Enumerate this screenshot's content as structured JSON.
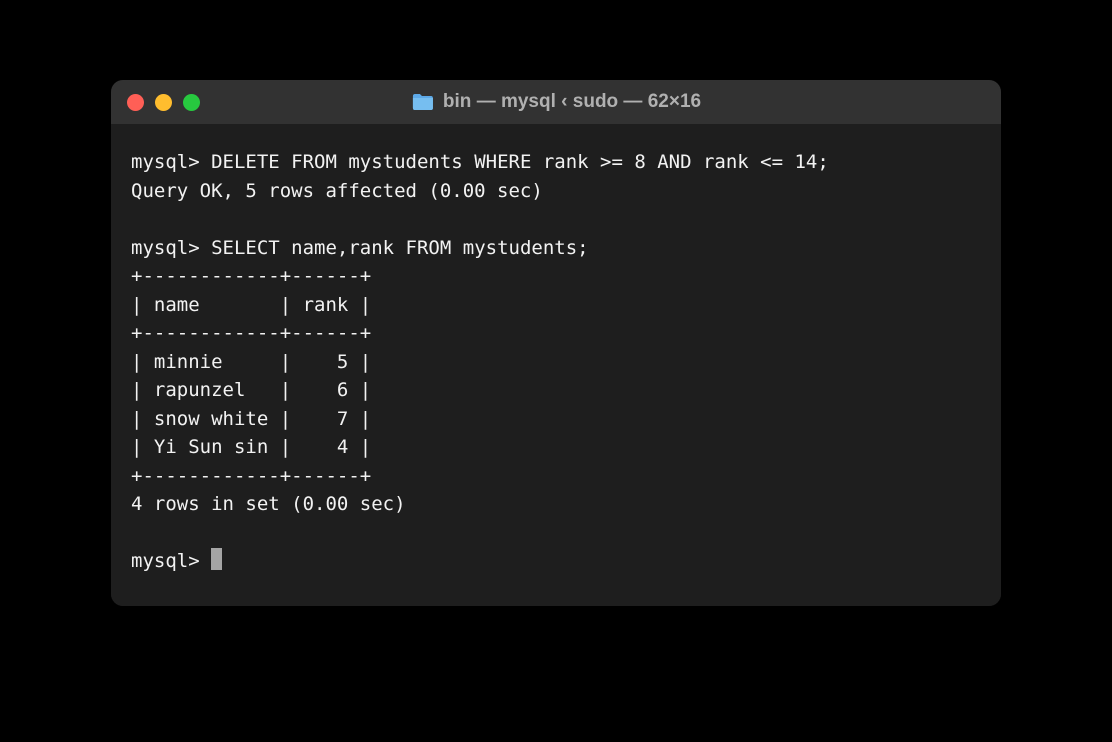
{
  "titlebar": {
    "title": "bin — mysql ‹ sudo — 62×16"
  },
  "terminal": {
    "prompt": "mysql>",
    "lines": {
      "cmd1": "DELETE FROM mystudents WHERE rank >= 8 AND rank <= 14;",
      "result1": "Query OK, 5 rows affected (0.00 sec)",
      "cmd2": "SELECT name,rank FROM mystudents;",
      "separator": "+------------+------+",
      "header": "| name       | rank |",
      "row1": "| minnie     |    5 |",
      "row2": "| rapunzel   |    6 |",
      "row3": "| snow white |    7 |",
      "row4": "| Yi Sun sin |    4 |",
      "footer": "4 rows in set (0.00 sec)"
    }
  }
}
